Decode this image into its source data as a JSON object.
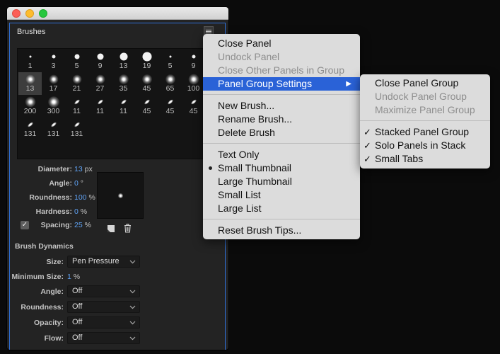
{
  "panel": {
    "tab_label": "Brushes"
  },
  "brush_tips": [
    {
      "size": "1",
      "selected": false
    },
    {
      "size": "3",
      "selected": false
    },
    {
      "size": "5",
      "selected": false
    },
    {
      "size": "9",
      "selected": false
    },
    {
      "size": "13",
      "selected": false
    },
    {
      "size": "19",
      "selected": false
    },
    {
      "size": "5",
      "selected": false
    },
    {
      "size": "9",
      "selected": false
    },
    {
      "size": "13",
      "selected": true
    },
    {
      "size": "17",
      "selected": false
    },
    {
      "size": "21",
      "selected": false
    },
    {
      "size": "27",
      "selected": false
    },
    {
      "size": "35",
      "selected": false
    },
    {
      "size": "45",
      "selected": false
    },
    {
      "size": "65",
      "selected": false
    },
    {
      "size": "100",
      "selected": false
    },
    {
      "size": "200",
      "selected": false
    },
    {
      "size": "300",
      "selected": false
    },
    {
      "size": "11",
      "selected": false
    },
    {
      "size": "11",
      "selected": false
    },
    {
      "size": "11",
      "selected": false
    },
    {
      "size": "45",
      "selected": false
    },
    {
      "size": "45",
      "selected": false
    },
    {
      "size": "45",
      "selected": false
    },
    {
      "size": "131",
      "selected": false
    },
    {
      "size": "131",
      "selected": false
    },
    {
      "size": "131",
      "selected": false
    }
  ],
  "properties": {
    "diameter": {
      "label": "Diameter:",
      "value": "13",
      "unit": "px"
    },
    "angle": {
      "label": "Angle:",
      "value": "0",
      "unit": "°"
    },
    "roundness": {
      "label": "Roundness:",
      "value": "100",
      "unit": "%"
    },
    "hardness": {
      "label": "Hardness:",
      "value": "0",
      "unit": "%"
    },
    "spacing": {
      "label": "Spacing:",
      "value": "25",
      "unit": "%",
      "checked": true
    }
  },
  "dynamics": {
    "title": "Brush Dynamics",
    "size": {
      "label": "Size:",
      "value": "Pen Pressure"
    },
    "minimum_size": {
      "label": "Minimum Size:",
      "value": "1",
      "unit": "%"
    },
    "angle": {
      "label": "Angle:",
      "value": "Off"
    },
    "roundness": {
      "label": "Roundness:",
      "value": "Off"
    },
    "opacity": {
      "label": "Opacity:",
      "value": "Off"
    },
    "flow": {
      "label": "Flow:",
      "value": "Off"
    }
  },
  "panel_menu": {
    "close_panel": "Close Panel",
    "undock_panel": "Undock Panel",
    "close_other_panels": "Close Other Panels in Group",
    "panel_group_settings": "Panel Group Settings",
    "new_brush": "New Brush...",
    "rename_brush": "Rename Brush...",
    "delete_brush": "Delete Brush",
    "text_only": "Text Only",
    "small_thumbnail": "Small Thumbnail",
    "large_thumbnail": "Large Thumbnail",
    "small_list": "Small List",
    "large_list": "Large List",
    "reset_brush_tips": "Reset Brush Tips..."
  },
  "group_submenu": {
    "close_panel_group": "Close Panel Group",
    "undock_panel_group": "Undock Panel Group",
    "maximize_panel_group": "Maximize Panel Group",
    "stacked_panel_group": "Stacked Panel Group",
    "solo_panels_in_stack": "Solo Panels in Stack",
    "small_tabs": "Small Tabs"
  },
  "colors": {
    "accent_blue": "#5fa2f4",
    "menu_highlight": "#2a62d7",
    "panel_border": "#2f6fd6"
  }
}
